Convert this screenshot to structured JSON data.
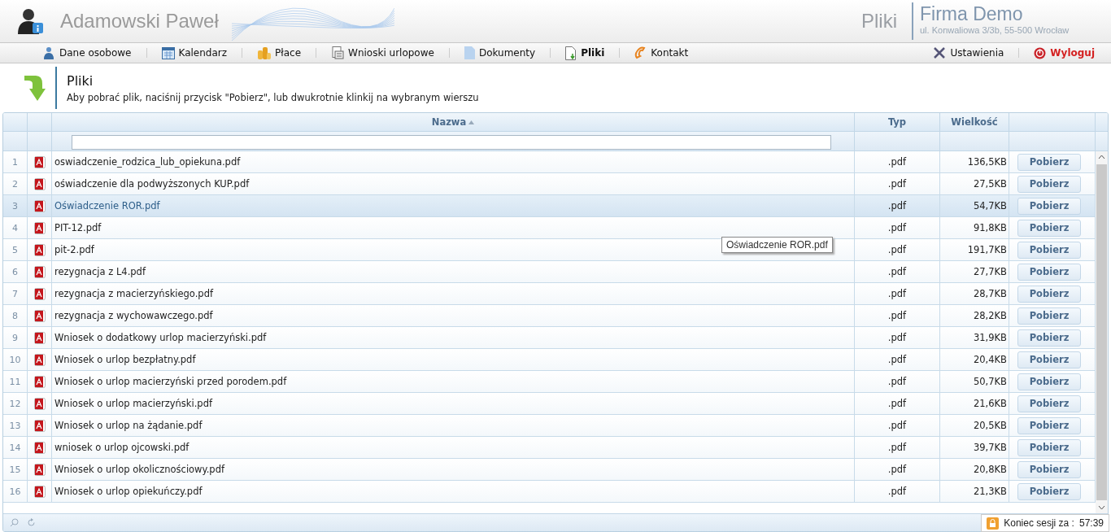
{
  "header": {
    "user_name": "Adamowski Paweł",
    "section": "Pliki",
    "company": "Firma Demo",
    "address": "ul. Konwaliowa 3/3b, 55-500 Wrocław"
  },
  "nav": [
    {
      "label": "Dane osobowe",
      "kind": "person",
      "selected": false
    },
    {
      "label": "Kalendarz",
      "kind": "calendar",
      "selected": false
    },
    {
      "label": "Płace",
      "kind": "coins",
      "selected": false
    },
    {
      "label": "Wnioski urlopowe",
      "kind": "form",
      "selected": false
    },
    {
      "label": "Dokumenty",
      "kind": "doc",
      "selected": false
    },
    {
      "label": "Pliki",
      "kind": "file",
      "selected": true
    },
    {
      "label": "Kontakt",
      "kind": "phone",
      "selected": false
    }
  ],
  "nav_right": [
    {
      "label": "Ustawienia",
      "kind": "settings"
    },
    {
      "label": "Wyloguj",
      "kind": "logout"
    }
  ],
  "page": {
    "title": "Pliki",
    "hint": "Aby pobrać plik, naciśnij przycisk \"Pobierz\", lub dwukrotnie klinkij na wybranym wierszu"
  },
  "table": {
    "columns": [
      {
        "label": "Nazwa",
        "sorted": true
      },
      {
        "label": "Typ",
        "sorted": false
      },
      {
        "label": "Wielkość",
        "sorted": false
      }
    ],
    "rows": [
      {
        "n": "1",
        "name": "oswiadczenie_rodzica_lub_opiekuna.pdf",
        "type": ".pdf",
        "size": "136,5KB",
        "button": "Pobierz",
        "selected": false
      },
      {
        "n": "2",
        "name": "oświadczenie dla podwyższonych KUP.pdf",
        "type": ".pdf",
        "size": "27,5KB",
        "button": "Pobierz",
        "selected": false
      },
      {
        "n": "3",
        "name": "Oświadczenie ROR.pdf",
        "type": ".pdf",
        "size": "54,7KB",
        "button": "Pobierz",
        "selected": true
      },
      {
        "n": "4",
        "name": "PIT-12.pdf",
        "type": ".pdf",
        "size": "91,8KB",
        "button": "Pobierz",
        "selected": false
      },
      {
        "n": "5",
        "name": "pit-2.pdf",
        "type": ".pdf",
        "size": "191,7KB",
        "button": "Pobierz",
        "selected": false
      },
      {
        "n": "6",
        "name": "rezygnacja z L4.pdf",
        "type": ".pdf",
        "size": "27,7KB",
        "button": "Pobierz",
        "selected": false
      },
      {
        "n": "7",
        "name": "rezygnacja z macierzyńskiego.pdf",
        "type": ".pdf",
        "size": "28,7KB",
        "button": "Pobierz",
        "selected": false
      },
      {
        "n": "8",
        "name": "rezygnacja z wychowawczego.pdf",
        "type": ".pdf",
        "size": "28,2KB",
        "button": "Pobierz",
        "selected": false
      },
      {
        "n": "9",
        "name": "Wniosek o dodatkowy urlop macierzyński.pdf",
        "type": ".pdf",
        "size": "31,9KB",
        "button": "Pobierz",
        "selected": false
      },
      {
        "n": "10",
        "name": "Wniosek o urlop bezpłatny.pdf",
        "type": ".pdf",
        "size": "20,4KB",
        "button": "Pobierz",
        "selected": false
      },
      {
        "n": "11",
        "name": "Wniosek o urlop macierzyński przed porodem.pdf",
        "type": ".pdf",
        "size": "50,7KB",
        "button": "Pobierz",
        "selected": false
      },
      {
        "n": "12",
        "name": "Wniosek o urlop macierzyński.pdf",
        "type": ".pdf",
        "size": "21,6KB",
        "button": "Pobierz",
        "selected": false
      },
      {
        "n": "13",
        "name": "Wniosek o urlop na żądanie.pdf",
        "type": ".pdf",
        "size": "20,5KB",
        "button": "Pobierz",
        "selected": false
      },
      {
        "n": "14",
        "name": "wniosek o urlop ojcowski.pdf",
        "type": ".pdf",
        "size": "39,7KB",
        "button": "Pobierz",
        "selected": false
      },
      {
        "n": "15",
        "name": "Wniosek o urlop okolicznościowy.pdf",
        "type": ".pdf",
        "size": "20,8KB",
        "button": "Pobierz",
        "selected": false
      },
      {
        "n": "16",
        "name": "Wniosek o urlop opiekuńczy.pdf",
        "type": ".pdf",
        "size": "21,3KB",
        "button": "Pobierz",
        "selected": false
      }
    ]
  },
  "tooltip": "Oświadczenie ROR.pdf",
  "session": {
    "label": "Koniec sesji za :",
    "time": "57:39"
  }
}
